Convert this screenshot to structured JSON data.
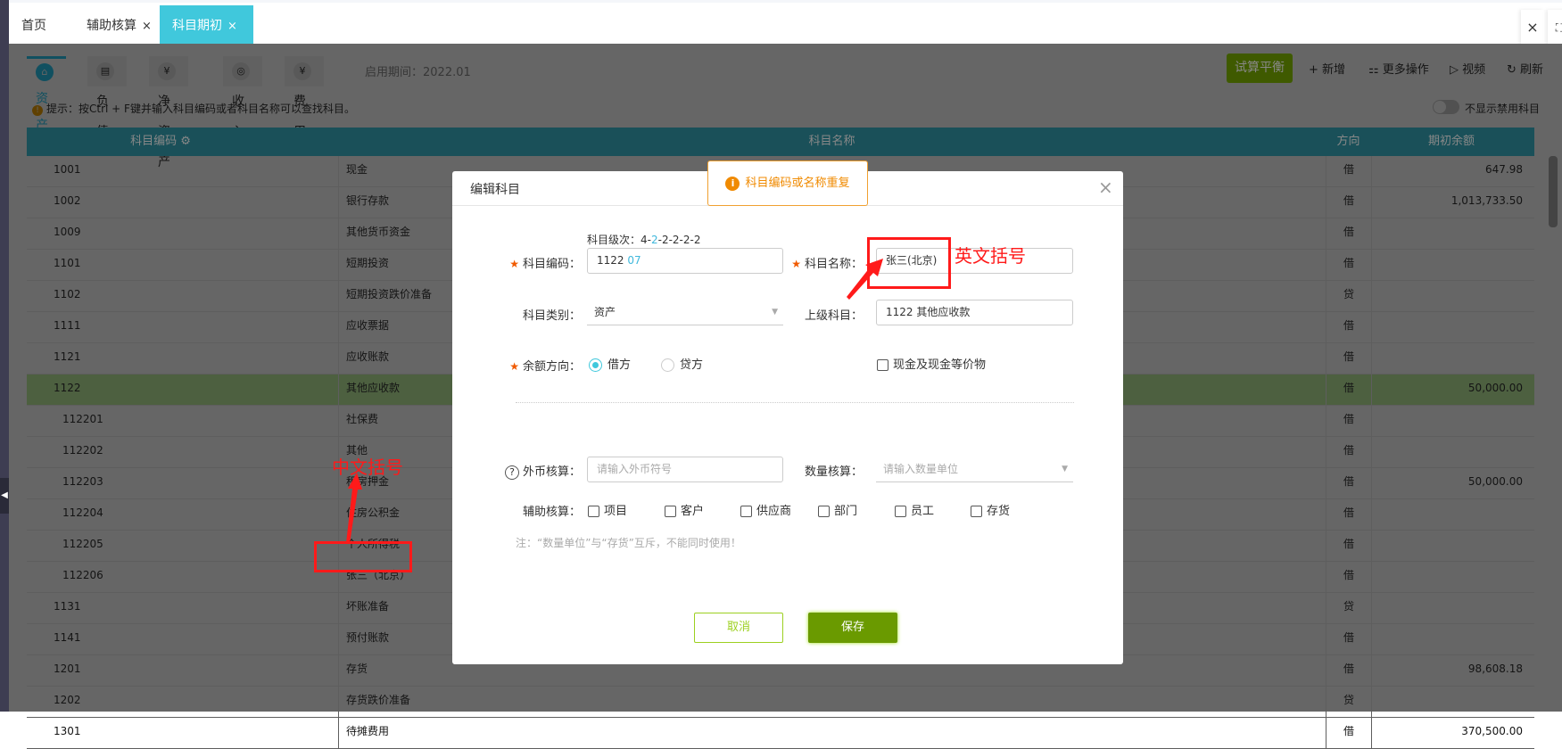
{
  "page_tabs": [
    {
      "label": "首页"
    },
    {
      "label": "辅助核算",
      "close": "×"
    },
    {
      "label": "科目期初",
      "close": "×",
      "active": true
    }
  ],
  "window_buttons": {
    "close": "×",
    "fullscreen": "⛶"
  },
  "account_tabs": [
    {
      "label": "资产",
      "icon": "asset-icon",
      "glyph": "⌂",
      "active": true
    },
    {
      "label": "负债",
      "icon": "liability-icon",
      "glyph": "▤"
    },
    {
      "label": "净资产",
      "icon": "equity-icon",
      "glyph": "¥"
    },
    {
      "label": "收入",
      "icon": "income-icon",
      "glyph": "◎"
    },
    {
      "label": "费用",
      "icon": "expense-icon",
      "glyph": "¥"
    }
  ],
  "period": "启用期间：2022.01",
  "toolbar": {
    "trial_balance": "试算平衡",
    "add": "新增",
    "add_glyph": "+",
    "more": "更多操作",
    "more_glyph": "⚏",
    "video": "视频",
    "video_glyph": "▷",
    "refresh": "刷新",
    "refresh_glyph": "↻"
  },
  "hint": "提示：按Ctrl + F键并输入科目编码或者科目名称可以查找科目。",
  "hide_disabled": {
    "label": "不显示禁用科目",
    "on": false
  },
  "table": {
    "headers": {
      "code": "科目编码",
      "name": "科目名称",
      "direction": "方向",
      "balance": "期初余额"
    },
    "rows": [
      {
        "code": "1001",
        "name": "现金",
        "dir": "借",
        "amount": "647.98"
      },
      {
        "code": "1002",
        "name": "银行存款",
        "dir": "借",
        "amount": "1,013,733.50"
      },
      {
        "code": "1009",
        "name": "其他货币资金",
        "dir": "借",
        "amount": ""
      },
      {
        "code": "1101",
        "name": "短期投资",
        "dir": "借",
        "amount": ""
      },
      {
        "code": "1102",
        "name": "短期投资跌价准备",
        "dir": "贷",
        "amount": ""
      },
      {
        "code": "1111",
        "name": "应收票据",
        "dir": "借",
        "amount": ""
      },
      {
        "code": "1121",
        "name": "应收账款",
        "dir": "借",
        "amount": ""
      },
      {
        "code": "1122",
        "name": "其他应收款",
        "dir": "借",
        "amount": "50,000.00",
        "selected": true
      },
      {
        "code": "112201",
        "name": "社保费",
        "dir": "借",
        "amount": "",
        "child": true
      },
      {
        "code": "112202",
        "name": "其他",
        "dir": "借",
        "amount": "",
        "child": true
      },
      {
        "code": "112203",
        "name": "租房押金",
        "dir": "借",
        "amount": "50,000.00",
        "child": true
      },
      {
        "code": "112204",
        "name": "住房公积金",
        "dir": "借",
        "amount": "",
        "child": true
      },
      {
        "code": "112205",
        "name": "个人所得税",
        "dir": "借",
        "amount": "",
        "child": true
      },
      {
        "code": "112206",
        "name": "张三（北京）",
        "dir": "借",
        "amount": "",
        "child": true
      },
      {
        "code": "1131",
        "name": "坏账准备",
        "dir": "贷",
        "amount": ""
      },
      {
        "code": "1141",
        "name": "预付账款",
        "dir": "借",
        "amount": ""
      },
      {
        "code": "1201",
        "name": "存货",
        "dir": "借",
        "amount": "98,608.18"
      },
      {
        "code": "1202",
        "name": "存货跌价准备",
        "dir": "贷",
        "amount": ""
      },
      {
        "code": "1301",
        "name": "待摊费用",
        "dir": "借",
        "amount": "370,500.00"
      }
    ]
  },
  "dialog": {
    "title": "编辑科目",
    "close": "×",
    "toast": "科目编码或名称重复",
    "level_prefix": "科目级次：4-",
    "level_hl": "2",
    "level_suffix": "-2-2-2-2",
    "code_label": "科目编码：",
    "code_prefix": "1122 ",
    "code_suffix": "07",
    "name_label": "科目名称：",
    "name_value": "张三(北京)",
    "category_label": "科目类别：",
    "category_value": "资产",
    "parent_label": "上级科目：",
    "parent_value": "1122 其他应收款",
    "direction_label": "余额方向：",
    "debit": "借方",
    "credit": "贷方",
    "direction_selected": "借方",
    "cash_equiv": "现金及现金等价物",
    "fx_label": "外币核算：",
    "fx_placeholder": "请输入外币符号",
    "qty_label": "数量核算：",
    "qty_placeholder": "请输入数量单位",
    "aux_label": "辅助核算：",
    "aux_options": [
      "项目",
      "客户",
      "供应商",
      "部门",
      "员工",
      "存货"
    ],
    "note": "注：“数量单位”与“存货”互斥，不能同时使用！",
    "cancel": "取消",
    "save": "保存"
  },
  "annotations": {
    "english": "英文括号",
    "chinese": "中文括号"
  },
  "colors": {
    "accent": "#40c8dc",
    "green": "#6a9a00",
    "warning": "#f08a00",
    "annotation": "#ff1a1a"
  }
}
